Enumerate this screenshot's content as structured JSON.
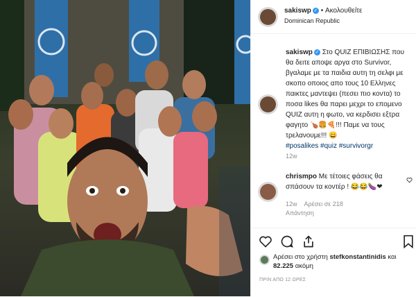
{
  "post": {
    "author": "sakiswp",
    "follow_label": "Ακολουθείτε",
    "location": "Dominican Republic",
    "caption": "Στο QUIZ ΕΠΙΒΙΩΣΗΣ που θα δειτε αποψε αργα στο Survivor, βγαλαμε με τα παιδια αυτη τη σελφι με σκοπο οποιος απο τους 10 Ελληνες παικτες μαντεψει (πεσει πιο κοντα) το ποσα likes θα παρει μεχρι το επομενο QUIZ αυτη η φωτο, να κερδισει εξτρα φαγητο 🍗🍔🍕!!! Παμε να τους τρελανουμε!!! 😄",
    "hashtags": [
      "#posalikes",
      "#quiz",
      "#survivorgr"
    ],
    "caption_time": "12w",
    "separator": "•"
  },
  "comment": {
    "user": "chrismpo",
    "text": "Με τέτοιες φάσεις θα σπάσουν τα κοντέρ ! 😂😂🍆❤",
    "time": "12w",
    "likes": "Αρέσει σε 218",
    "reply_label": "Απάντηση"
  },
  "likes": {
    "prefix": "Αρέσει στο χρήστη",
    "user": "stefkonstantinidis",
    "middle": "και",
    "count": "82.225",
    "suffix": "ακόμη"
  },
  "timestamp": "ΠΡΙΝ ΑΠΟ 12 ΩΡΕΣ",
  "icons": {
    "like": "heart-icon",
    "comment": "comment-icon",
    "share": "share-icon",
    "save": "bookmark-icon",
    "more": "more-icon",
    "comment_like": "heart-icon"
  },
  "colors": {
    "verified": "#3897f0",
    "hashtag": "#003569",
    "muted": "#8e8e8e"
  }
}
